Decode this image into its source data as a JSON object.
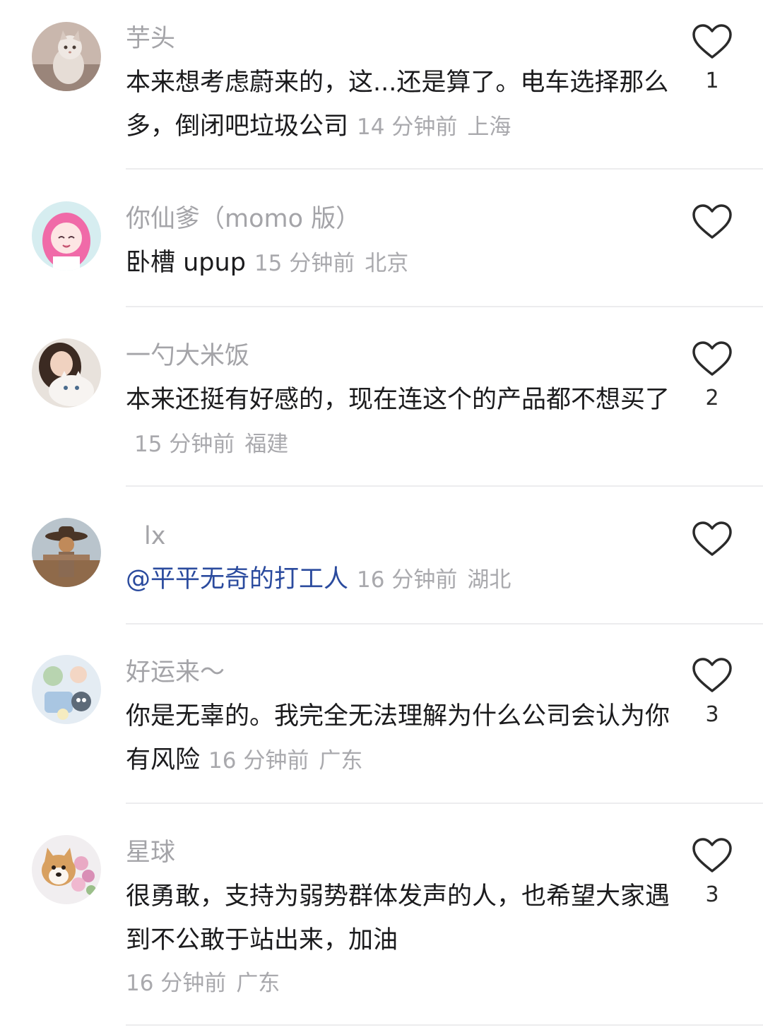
{
  "comments": [
    {
      "username": "芋头",
      "text": "本来想考虑蔚来的，这...还是算了。电车选择那么多，倒闭吧垃圾公司",
      "time": "14 分钟前",
      "location": "上海",
      "likes": "1",
      "avatar_icon": "cat-avatar-icon"
    },
    {
      "username": "你仙爹（momo 版）",
      "text": "卧槽 upup",
      "time": "15 分钟前",
      "location": "北京",
      "likes": "",
      "avatar_icon": "anime-girl-avatar-icon"
    },
    {
      "username": "一勺大米饭",
      "text": "本来还挺有好感的，现在连这个的产品都不想买了",
      "time": "15 分钟前",
      "location": "福建",
      "likes": "2",
      "avatar_icon": "girl-with-cat-avatar-icon"
    },
    {
      "username": "lx",
      "text": "@平平无奇的打工人",
      "time": "16 分钟前",
      "location": "湖北",
      "likes": "",
      "avatar_icon": "scarecrow-avatar-icon"
    },
    {
      "username": "好运来～",
      "text": "你是无辜的。我完全无法理解为什么公司会认为你有风险",
      "time": "16 分钟前",
      "location": "广东",
      "likes": "3",
      "avatar_icon": "pastel-illustration-avatar-icon"
    },
    {
      "username": "星球",
      "text": "很勇敢，支持为弱势群体发声的人，也希望大家遇到不公敢于站出来，加油",
      "time": "16 分钟前",
      "location": "广东",
      "likes": "3",
      "avatar_icon": "dog-with-flowers-avatar-icon"
    }
  ],
  "colors": {
    "username": "#a4a4a8",
    "meta": "#a9a9ad",
    "text": "#1b1b1d",
    "mention": "#2b4b9e",
    "divider": "#ececee"
  }
}
